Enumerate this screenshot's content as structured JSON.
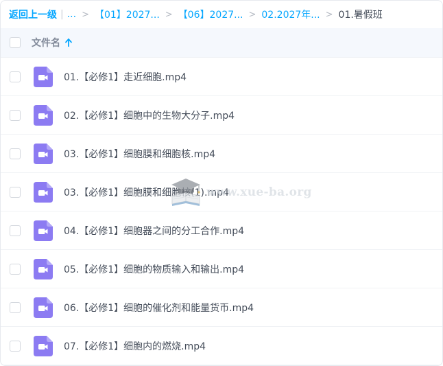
{
  "breadcrumb": {
    "back_label": "返回上一级",
    "ellipsis": "...",
    "separator": ">",
    "items": [
      {
        "label": "【01】2027..."
      },
      {
        "label": "【06】2027..."
      },
      {
        "label": "02.2027年..."
      }
    ],
    "current": "01.暑假班"
  },
  "header": {
    "column_label": "文件名",
    "sort_icon": "arrow-up-icon"
  },
  "files": [
    {
      "name": "01.【必修1】走近细胞.mp4",
      "icon": "video-file-icon"
    },
    {
      "name": "02.【必修1】细胞中的生物大分子.mp4",
      "icon": "video-file-icon"
    },
    {
      "name": "03.【必修1】细胞膜和细胞核.mp4",
      "icon": "video-file-icon"
    },
    {
      "name": "03.【必修1】细胞膜和细胞核(1).mp4",
      "icon": "video-file-icon"
    },
    {
      "name": "04.【必修1】细胞器之间的分工合作.mp4",
      "icon": "video-file-icon"
    },
    {
      "name": "05.【必修1】细胞的物质输入和输出.mp4",
      "icon": "video-file-icon"
    },
    {
      "name": "06.【必修1】细胞的催化剂和能量货币.mp4",
      "icon": "video-file-icon"
    },
    {
      "name": "07.【必修1】细胞内的燃烧.mp4",
      "icon": "video-file-icon"
    }
  ],
  "watermark": {
    "text": "www.xue-ba.org",
    "icon": "graduation-cap-book-icon"
  },
  "colors": {
    "link": "#06a7ff",
    "text": "#454d5a",
    "icon_purple": "#8c7bf2",
    "header_bg": "#f5f8fd"
  }
}
